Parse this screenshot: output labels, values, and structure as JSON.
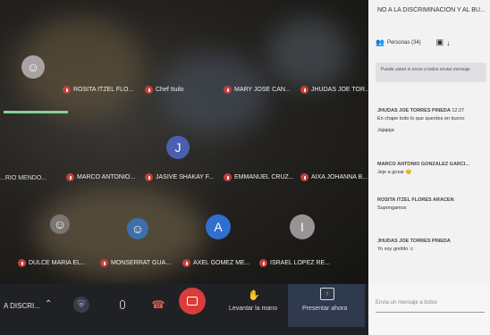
{
  "participants": [
    {
      "name": "ROSITA ITZEL FLO...",
      "initial": ""
    },
    {
      "name": "Chef Ituilo",
      "initial": ""
    },
    {
      "name": "MARY JOSE CAN...",
      "initial": ""
    },
    {
      "name": "JHUDAS JOE TOR...",
      "initial": ""
    },
    {
      "name": "MARCO ANTONIO...",
      "initial": ""
    },
    {
      "name": "JASIVE SHAKAY F...",
      "initial": "J"
    },
    {
      "name": "EMMANUEL CRUZ...",
      "initial": ""
    },
    {
      "name": "AIXA JOHANNA B...",
      "initial": ""
    },
    {
      "name": "DULCE MARIA EL...",
      "initial": ""
    },
    {
      "name": "MONSERRAT GUA...",
      "initial": ""
    },
    {
      "name": "AXEL GOMEZ ME...",
      "initial": "A"
    },
    {
      "name": "ISRAEL LOPEZ RE...",
      "initial": "I"
    }
  ],
  "side_labels": {
    "left_top": "",
    "left_mid": "...RIO MENDO..."
  },
  "panel": {
    "title": "NO A LA DISCRIMINACION Y AL BU...",
    "people_tab": "Personas (34)",
    "notice": "Puede usted el envio a todos enviar mensaje"
  },
  "chat": [
    {
      "who": "JHUDAS JOE TORRES PINEDA",
      "time": "12:27",
      "text": "En chape todo lo que querdes en bucno",
      "text2": "Jajajaja"
    },
    {
      "who": "MARCO ANTONIO GONZALEZ GARCI...",
      "time": "",
      "text": "Jeje a gozar 😊",
      "text2": ""
    },
    {
      "who": "ROSITA ITZEL FLORES ARACEN",
      "time": "",
      "text": "Supongamos",
      "text2": ""
    },
    {
      "who": "JHUDAS JOE TORRES PINEDA",
      "time": "",
      "text": "Yo soy goritito :c",
      "text2": ""
    }
  ],
  "toolbar": {
    "meeting_name": "A DISCRI...",
    "raise_hand": "Levantar la mano",
    "present_now": "Presentar ahora",
    "message_placeholder": "Envia un mensaje a todos"
  },
  "colors": {
    "end_call": "#d93d3a",
    "mic_muted": "#c6403a",
    "accent": "#4a79d6"
  }
}
